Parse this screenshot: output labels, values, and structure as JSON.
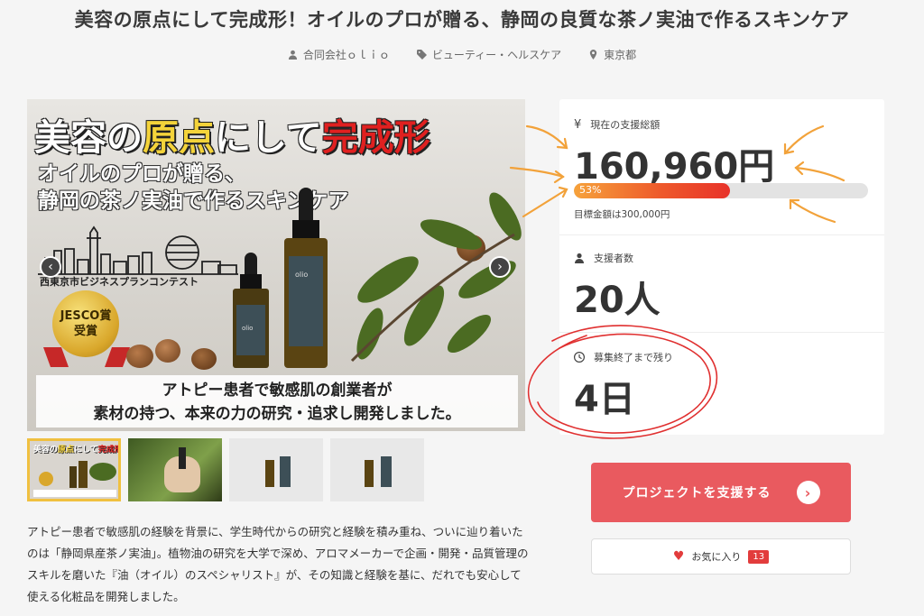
{
  "page": {
    "title": "美容の原点にして完成形！オイルのプロが贈る、静岡の良質な茶ノ実油で作るスキンケア"
  },
  "meta": {
    "company": "合同会社ｏｌｉｏ",
    "category": "ビューティー・ヘルスケア",
    "location": "東京都"
  },
  "hero": {
    "headline_white_1": "美容の",
    "headline_yellow": "原点",
    "headline_white_2": "にして",
    "headline_red": "完成形",
    "subline_1": "オイルのプロが贈る、",
    "subline_2": "静岡の茶ノ実油で作るスキンケア",
    "contest": "西東京市ビジネスプランコンテスト",
    "award_1": "JESCO賞",
    "award_2": "受賞",
    "bottle_brand": "olio",
    "band_1": "アトピー患者で敏感肌の創業者が",
    "band_2": "素材の持つ、本来の力の研究・追求し開発しました。",
    "prev_arrow": "‹",
    "next_arrow": "›"
  },
  "thumbnails": [
    {
      "name": "thumb-1",
      "active": true
    },
    {
      "name": "thumb-2",
      "active": false
    },
    {
      "name": "thumb-3",
      "active": false
    },
    {
      "name": "thumb-4",
      "active": false
    }
  ],
  "description": "アトピー患者で敏感肌の経験を背景に、学生時代からの研究と経験を積み重ね、ついに辿り着いたのは「静岡県産茶ノ実油」。植物油の研究を大学で深め、アロマメーカーで企画・開発・品質管理のスキルを磨いた『油（オイル）のスペシャリスト』が、その知識と経験を基に、だれでも安心して使える化粧品を開発しました。",
  "stats": {
    "total_label": "現在の支援総額",
    "total_value": "160,960円",
    "progress_percent": 53,
    "progress_label": "53%",
    "goal_text": "目標金額は300,000円",
    "backers_label": "支援者数",
    "backers_value": "20人",
    "remaining_label": "募集終了まで残り",
    "remaining_value": "4日",
    "yen_symbol": "¥"
  },
  "actions": {
    "support_label": "プロジェクトを支援する",
    "support_icon": "›",
    "favorite_label": "お気に入り",
    "favorite_count": "13"
  },
  "colors": {
    "accent": "#e95a5f",
    "progress_start": "#f6a23b",
    "progress_end": "#e8322a",
    "annotation_orange": "#f2a23a",
    "annotation_red": "#e03030"
  }
}
